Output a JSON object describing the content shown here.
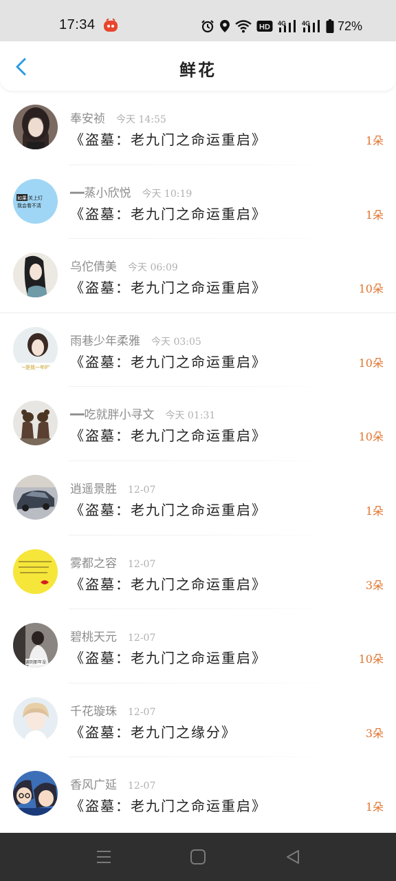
{
  "status_bar": {
    "time": "17:34",
    "battery": "72%",
    "icons": [
      "app-notification-icon",
      "alarm-icon",
      "location-icon",
      "wifi-icon",
      "hd-icon",
      "signal-4g-icon",
      "signal-4g-icon",
      "battery-icon"
    ],
    "hd_label": "HD",
    "network_label": "4G"
  },
  "header": {
    "title": "鲜花",
    "back_icon": "chevron-left-icon"
  },
  "colors": {
    "accent": "#2a9be6",
    "count": "#e0742e",
    "name": "#8c8c8c",
    "time": "#b0b0b0",
    "nav_bar": "#2f2f2f"
  },
  "gifts": [
    {
      "name": "奉安祯",
      "time": "今天 14:55",
      "book": "《盗墓：老九门之命运重启》",
      "count": "1朵"
    },
    {
      "name": "━━蒸小欣悦",
      "time": "今天 10:19",
      "book": "《盗墓：老九门之命运重启》",
      "count": "1朵"
    },
    {
      "name": "乌佗倩美",
      "time": "今天 06:09",
      "book": "《盗墓：老九门之命运重启》",
      "count": "10朵"
    },
    {
      "name": "雨巷少年柔雅",
      "time": "今天 03:05",
      "book": "《盗墓：老九门之命运重启》",
      "count": "10朵"
    },
    {
      "name": "━━吃就胖小寻文",
      "time": "今天 01:31",
      "book": "《盗墓：老九门之命运重启》",
      "count": "10朵"
    },
    {
      "name": "逍遥景胜",
      "time": "12-07",
      "book": "《盗墓：老九门之命运重启》",
      "count": "1朵"
    },
    {
      "name": "雾都之容",
      "time": "12-07",
      "book": "《盗墓：老九门之命运重启》",
      "count": "3朵"
    },
    {
      "name": "碧桃天元",
      "time": "12-07",
      "book": "《盗墓：老九门之命运重启》",
      "count": "10朵"
    },
    {
      "name": "千花璇珠",
      "time": "12-07",
      "book": "《盗墓：老九门之缘分》",
      "count": "3朵"
    },
    {
      "name": "香风广延",
      "time": "12-07",
      "book": "《盗墓：老九门之命运重启》",
      "count": "1朵"
    }
  ],
  "avatar_texts": {
    "a2_line1": "如果",
    "a2_line1b": "关上灯",
    "a2_line2": "我会看不清",
    "a4_caption": "一是我一年的",
    "a8_caption": "调到那年没"
  },
  "nav_bar": {
    "buttons": [
      "menu-icon",
      "home-square-icon",
      "back-triangle-icon"
    ]
  }
}
